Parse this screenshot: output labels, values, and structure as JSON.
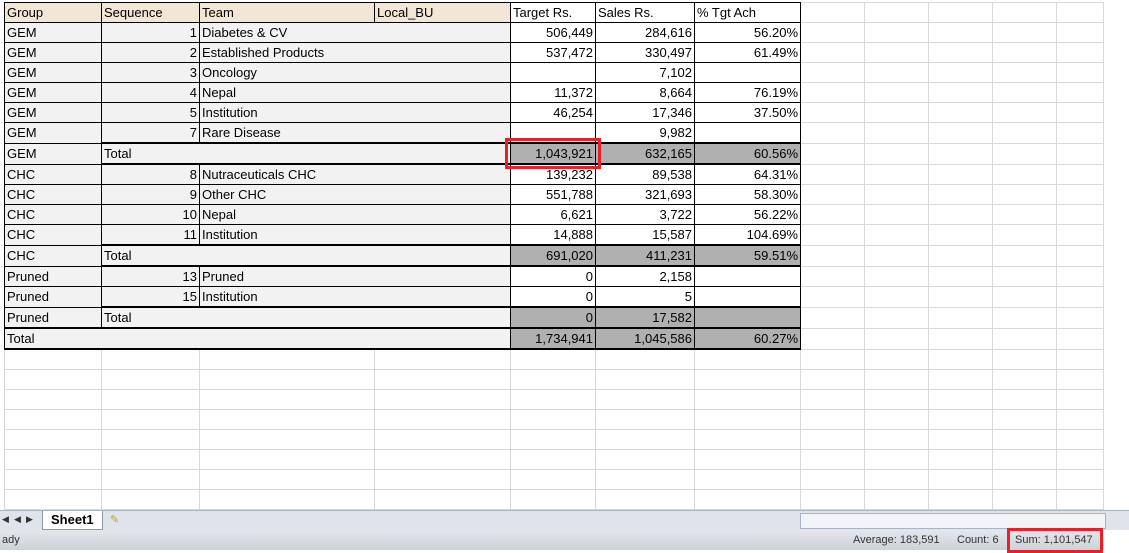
{
  "headers": [
    "Group",
    "Sequence",
    "Team",
    "Local_BU",
    "Target Rs.",
    "Sales Rs.",
    "% Tgt Ach"
  ],
  "rows": [
    {
      "group": "GEM",
      "seq": "1",
      "team": "Diabetes & CV",
      "target": "506,449",
      "sales": "284,616",
      "pct": "56.20%"
    },
    {
      "group": "GEM",
      "seq": "2",
      "team": "Established Products",
      "target": "537,472",
      "sales": "330,497",
      "pct": "61.49%"
    },
    {
      "group": "GEM",
      "seq": "3",
      "team": "Oncology",
      "target": "",
      "sales": "7,102",
      "pct": ""
    },
    {
      "group": "GEM",
      "seq": "4",
      "team": "Nepal",
      "target": "11,372",
      "sales": "8,664",
      "pct": "76.19%"
    },
    {
      "group": "GEM",
      "seq": "5",
      "team": "Institution",
      "target": "46,254",
      "sales": "17,346",
      "pct": "37.50%"
    },
    {
      "group": "GEM",
      "seq": "7",
      "team": "Rare Disease",
      "target": "",
      "sales": "9,982",
      "pct": ""
    },
    {
      "group": "GEM",
      "total": "Total",
      "target": "1,043,921",
      "sales": "632,165",
      "pct": "60.56%",
      "selected": true
    },
    {
      "group": "CHC",
      "seq": "8",
      "team": "Nutraceuticals CHC",
      "target": "139,232",
      "sales": "89,538",
      "pct": "64.31%"
    },
    {
      "group": "CHC",
      "seq": "9",
      "team": "Other CHC",
      "target": "551,788",
      "sales": "321,693",
      "pct": "58.30%"
    },
    {
      "group": "CHC",
      "seq": "10",
      "team": "Nepal",
      "target": "6,621",
      "sales": "3,722",
      "pct": "56.22%"
    },
    {
      "group": "CHC",
      "seq": "11",
      "team": "Institution",
      "target": "14,888",
      "sales": "15,587",
      "pct": "104.69%"
    },
    {
      "group": "CHC",
      "total": "Total",
      "target": "691,020",
      "sales": "411,231",
      "pct": "59.51%"
    },
    {
      "group": "Pruned",
      "seq": "13",
      "team": "Pruned",
      "target": "0",
      "sales": "2,158",
      "pct": ""
    },
    {
      "group": "Pruned",
      "seq": "15",
      "team": "Institution",
      "target": "0",
      "sales": "5",
      "pct": ""
    },
    {
      "group": "Pruned",
      "total": "Total",
      "target": "0",
      "sales": "17,582",
      "pct": ""
    },
    {
      "grand": "Total",
      "target": "1,734,941",
      "sales": "1,045,586",
      "pct": "60.27%"
    }
  ],
  "sheet_tab": "Sheet1",
  "status": {
    "mode": "ady",
    "average": "Average: 183,591",
    "count": "Count: 6",
    "sum": "Sum: 1,101,547"
  },
  "colors": {
    "highlight": "#e8202a",
    "total_fill": "#b0b0b0",
    "header_fill": "#f2e6d5"
  }
}
